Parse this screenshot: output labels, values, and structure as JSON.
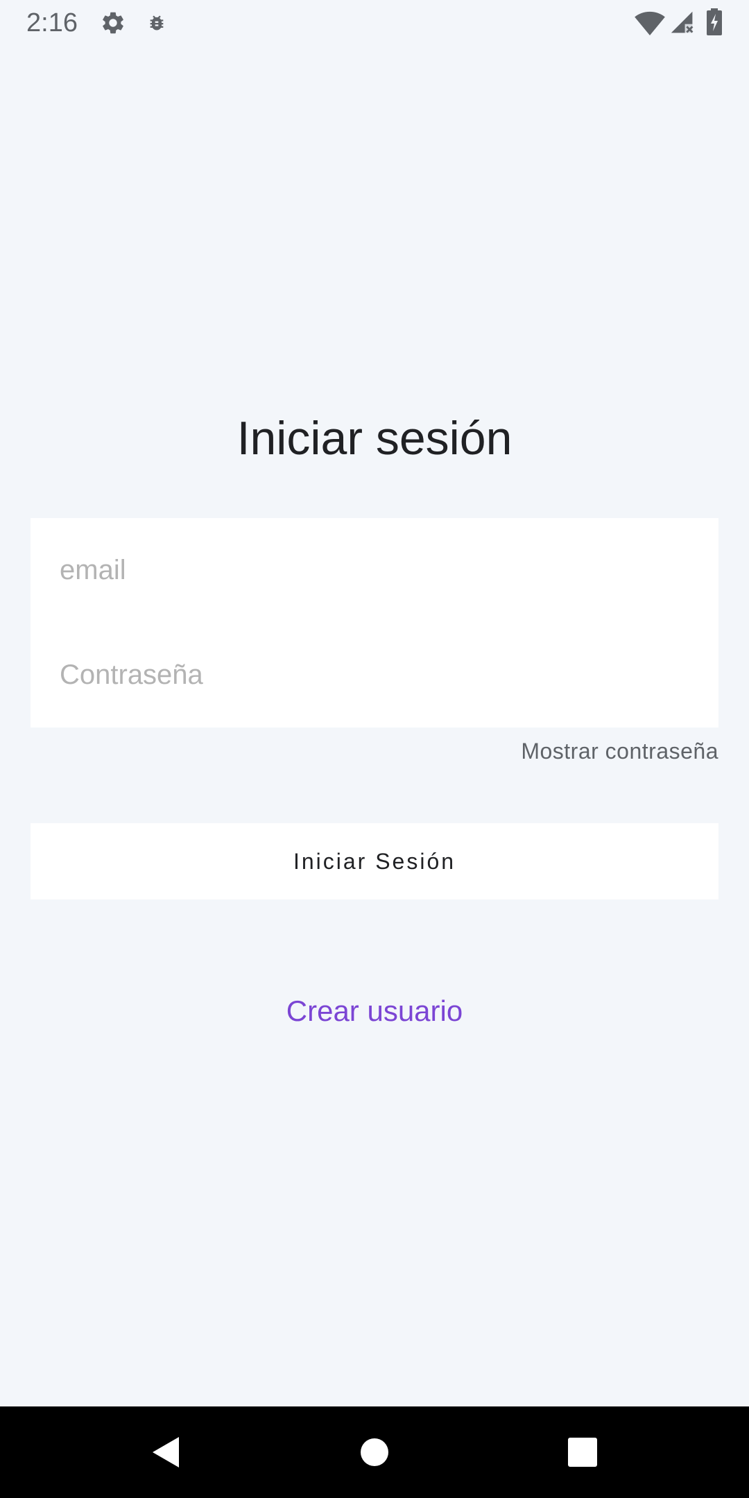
{
  "status_bar": {
    "time": "2:16",
    "icons": [
      "gear-icon",
      "debug-icon",
      "wifi-icon",
      "signal-icon",
      "battery-icon"
    ],
    "icon_color": "#5f6368"
  },
  "login": {
    "title": "Iniciar sesión",
    "email_placeholder": "email",
    "email_value": "",
    "password_placeholder": "Contraseña",
    "password_value": "",
    "show_password_label": "Mostrar contraseña",
    "submit_label": "Iniciar Sesión",
    "create_user_label": "Crear usuario"
  },
  "nav_bar": {
    "buttons": [
      "back-icon",
      "home-icon",
      "recents-icon"
    ]
  },
  "colors": {
    "background": "#f3f6fa",
    "card": "#ffffff",
    "text": "#202124",
    "placeholder": "#b3b3b3",
    "secondary_text": "#5f6368",
    "link": "#7b45d4",
    "nav_bar": "#000000"
  }
}
